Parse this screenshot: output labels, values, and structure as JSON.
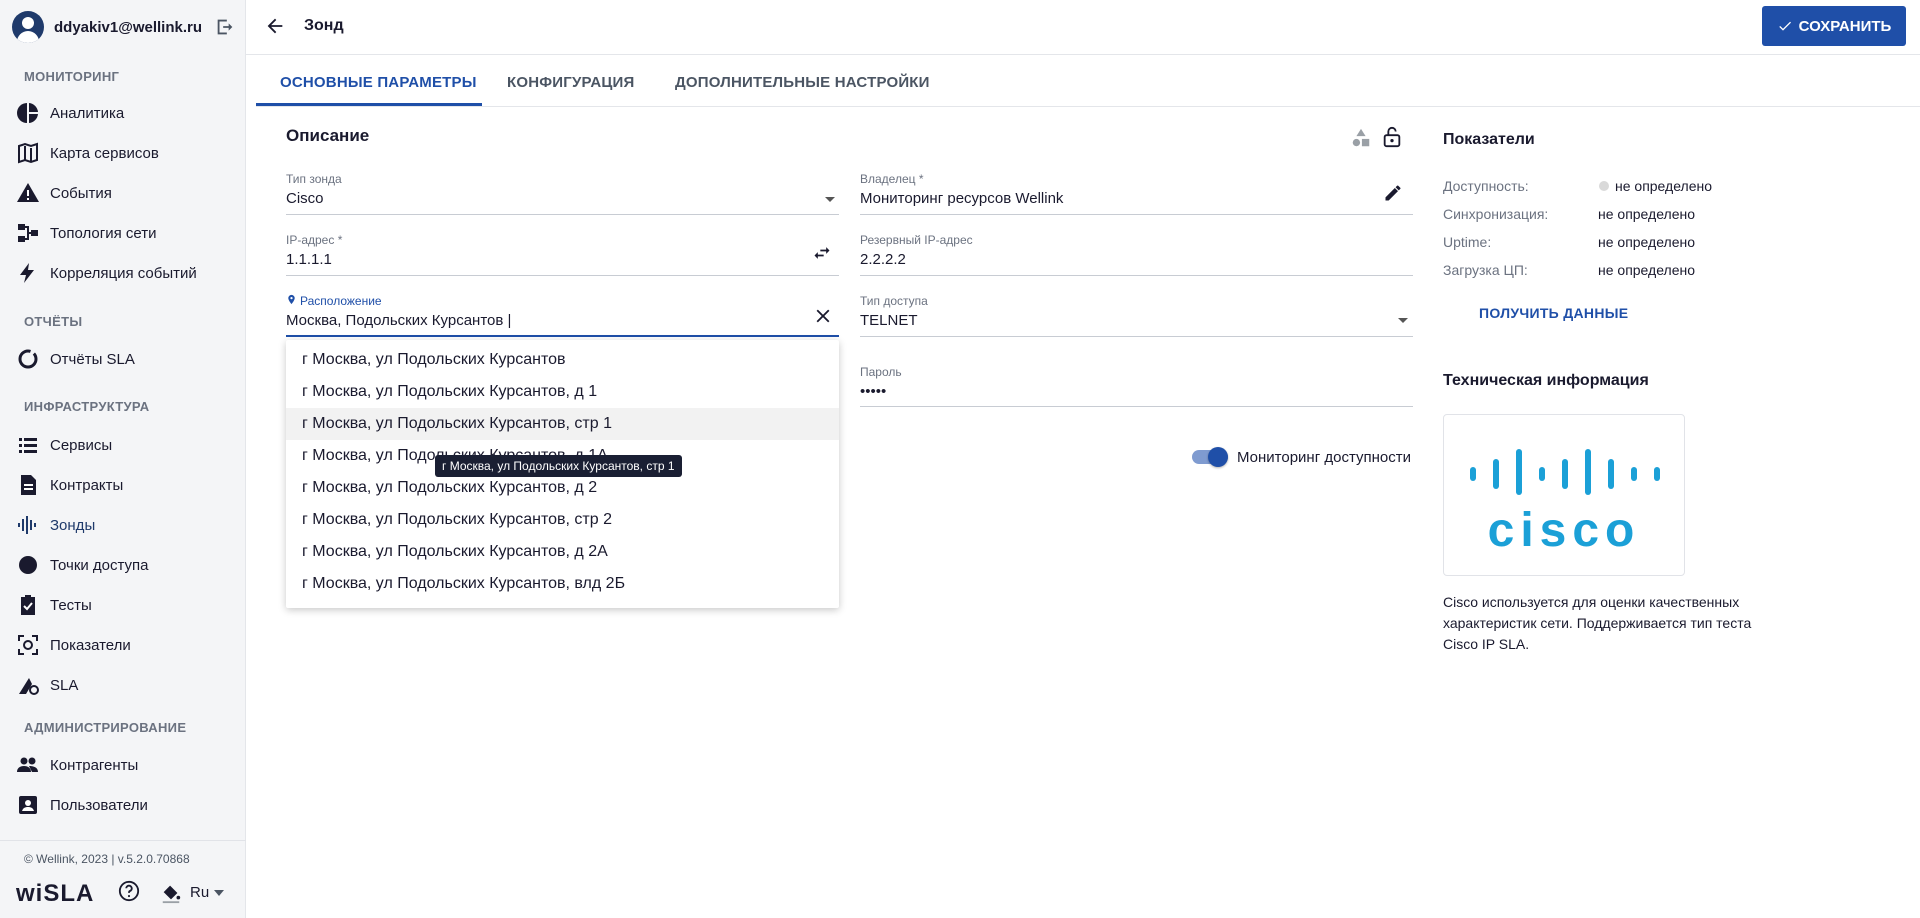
{
  "user": {
    "email": "ddyakiv1@wellink.ru"
  },
  "sidebar": {
    "sections": {
      "monitoring": "МОНИТОРИНГ",
      "reports": "ОТЧЁТЫ",
      "infrastructure": "ИНФРАСТРУКТУРА",
      "administration": "АДМИНИСТРИРОВАНИЕ"
    },
    "items": {
      "analytics": "Аналитика",
      "service_map": "Карта сервисов",
      "events": "События",
      "topology": "Топология сети",
      "correlation": "Корреляция событий",
      "sla_reports": "Отчёты SLA",
      "services": "Сервисы",
      "contracts": "Контракты",
      "probes": "Зонды",
      "access_points": "Точки доступа",
      "tests": "Тесты",
      "metrics": "Показатели",
      "sla": "SLA",
      "contractors": "Контрагенты",
      "users": "Пользователи"
    },
    "copyright": "© Wellink, 2023 | v.5.2.0.70868",
    "brand": "wiSLA",
    "language": "Ru"
  },
  "header": {
    "title": "Зонд",
    "save_label": "СОХРАНИТЬ"
  },
  "tabs": {
    "main": "ОСНОВНЫЕ ПАРАМЕТРЫ",
    "config": "КОНФИГУРАЦИЯ",
    "advanced": "ДОПОЛНИТЕЛЬНЫЕ НАСТРОЙКИ"
  },
  "form": {
    "title": "Описание",
    "probe_type": {
      "label": "Тип зонда",
      "value": "Cisco"
    },
    "owner": {
      "label": "Владелец *",
      "value": "Мониторинг ресурсов Wellink"
    },
    "ip": {
      "label": "IP-адрес *",
      "value": "1.1.1.1"
    },
    "backup_ip": {
      "label": "Резервный IP-адрес",
      "value": "2.2.2.2"
    },
    "location": {
      "label": "Расположение",
      "value": "Москва, Подольских Курсантов |"
    },
    "access_type": {
      "label": "Тип доступа",
      "value": "TELNET"
    },
    "password": {
      "label": "Пароль",
      "value": "•••••"
    },
    "monitoring_toggle": "Мониторинг доступности"
  },
  "dropdown": {
    "items": [
      "г Москва, ул Подольских Курсантов",
      "г Москва, ул Подольских Курсантов, д 1",
      "г Москва, ул Подольских Курсантов, стр 1",
      "г Москва, ул Подольских Курсантов, д 1А",
      "г Москва, ул Подольских Курсантов, д 2",
      "г Москва, ул Подольских Курсантов, стр 2",
      "г Москва, ул Подольских Курсантов, д 2А",
      "г Москва, ул Подольских Курсантов, влд 2Б"
    ],
    "tooltip": "г Москва, ул Подольских Курсантов, стр 1"
  },
  "metrics": {
    "title": "Показатели",
    "availability": {
      "label": "Доступность:",
      "value": "не определено"
    },
    "sync": {
      "label": "Синхронизация:",
      "value": "не определено"
    },
    "uptime": {
      "label": "Uptime:",
      "value": "не определено"
    },
    "cpu": {
      "label": "Загрузка ЦП:",
      "value": "не определено"
    },
    "get_data": "ПОЛУЧИТЬ ДАННЫЕ"
  },
  "tech": {
    "title": "Техническая информация",
    "logo_text": "cisco",
    "description": "Cisco используется для оценки качественных характеристик сети. Поддерживается тип теста Cisco IP SLA."
  },
  "colors": {
    "accent": "#1f4fa8",
    "cisco": "#1ba0d7"
  }
}
